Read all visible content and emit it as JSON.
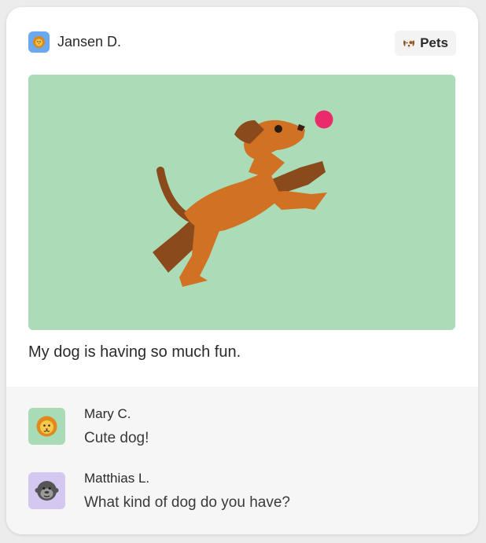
{
  "post": {
    "author": "Jansen D.",
    "author_avatar_icon": "lion-icon",
    "author_avatar_color": "#6aa8f0",
    "category_icon": "dog-face-icon",
    "category": "Pets",
    "image_icon": "dog-catching-ball-illustration",
    "image_bg": "#acdbb7",
    "caption": "My dog is having so much fun."
  },
  "comments": [
    {
      "author": "Mary C.",
      "avatar_icon": "lion-icon",
      "avatar_color": "#a9dbb6",
      "text": "Cute dog!"
    },
    {
      "author": "Matthias L.",
      "avatar_icon": "gorilla-icon",
      "avatar_color": "#d4c8f0",
      "text": "What kind of dog do you have?"
    }
  ]
}
